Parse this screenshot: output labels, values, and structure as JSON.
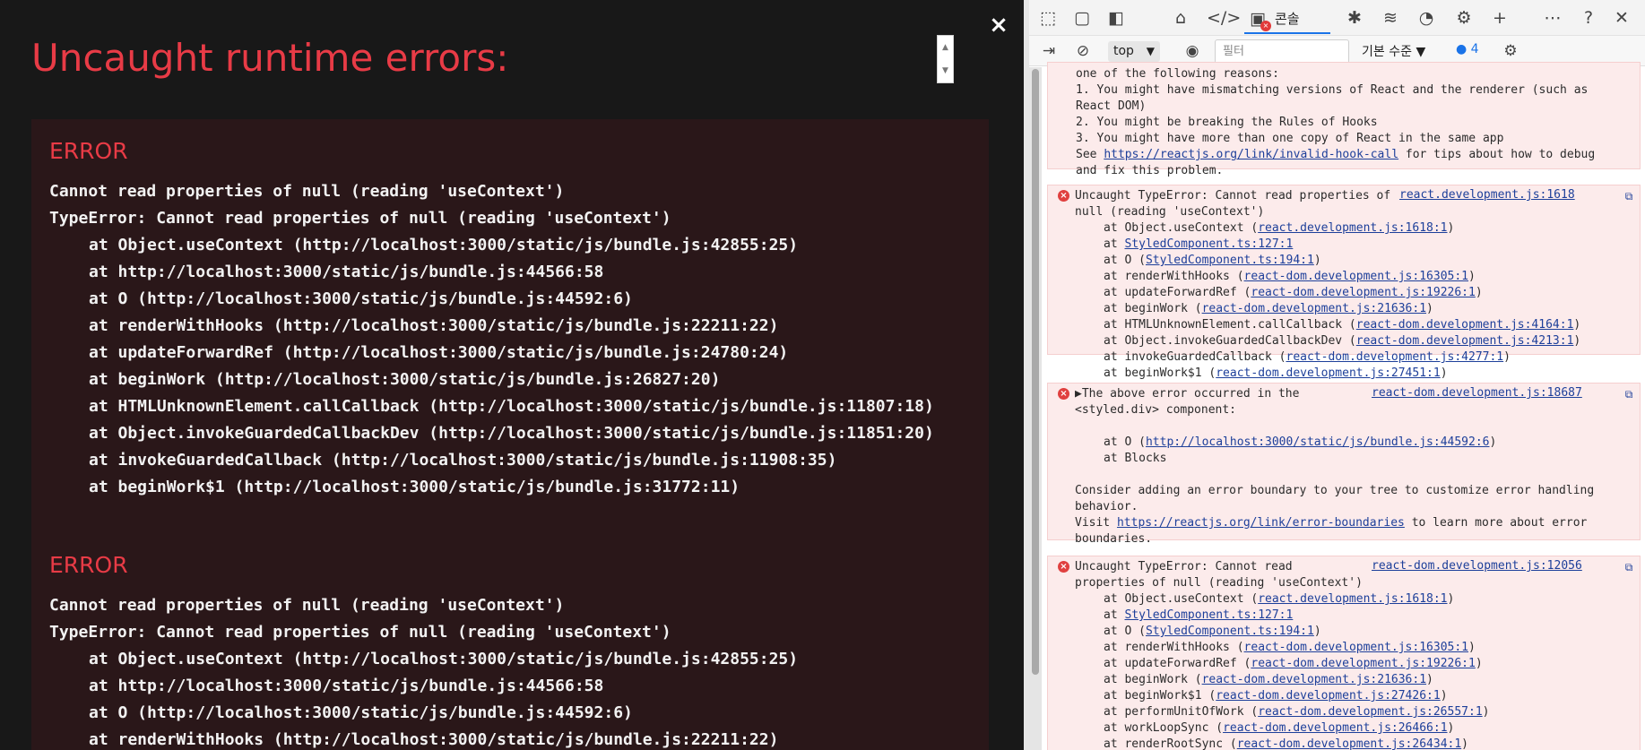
{
  "overlay": {
    "title": "Uncaught runtime errors:",
    "close_label": "×",
    "errors": [
      {
        "heading": "ERROR",
        "lines": [
          "Cannot read properties of null (reading 'useContext')",
          "TypeError: Cannot read properties of null (reading 'useContext')"
        ],
        "stack": [
          "at Object.useContext (http://localhost:3000/static/js/bundle.js:42855:25)",
          "at http://localhost:3000/static/js/bundle.js:44566:58",
          "at O (http://localhost:3000/static/js/bundle.js:44592:6)",
          "at renderWithHooks (http://localhost:3000/static/js/bundle.js:22211:22)",
          "at updateForwardRef (http://localhost:3000/static/js/bundle.js:24780:24)",
          "at beginWork (http://localhost:3000/static/js/bundle.js:26827:20)",
          "at HTMLUnknownElement.callCallback (http://localhost:3000/static/js/bundle.js:11807:18)",
          "at Object.invokeGuardedCallbackDev (http://localhost:3000/static/js/bundle.js:11851:20)",
          "at invokeGuardedCallback (http://localhost:3000/static/js/bundle.js:11908:35)",
          "at beginWork$1 (http://localhost:3000/static/js/bundle.js:31772:11)"
        ]
      },
      {
        "heading": "ERROR",
        "lines": [
          "Cannot read properties of null (reading 'useContext')",
          "TypeError: Cannot read properties of null (reading 'useContext')"
        ],
        "stack": [
          "at Object.useContext (http://localhost:3000/static/js/bundle.js:42855:25)",
          "at http://localhost:3000/static/js/bundle.js:44566:58",
          "at O (http://localhost:3000/static/js/bundle.js:44592:6)",
          "at renderWithHooks (http://localhost:3000/static/js/bundle.js:22211:22)"
        ]
      }
    ]
  },
  "devtools": {
    "console_tab_label": "콘솔",
    "console_badge": "×",
    "context": "top",
    "filter_placeholder": "필터",
    "levels_label": "기본 수준",
    "issues_count": "4",
    "icons": {
      "inspect": "inspect-element-icon",
      "device": "device-emulation-icon",
      "dock": "dock-side-icon",
      "welcome": "home-icon",
      "elements": "elements-icon",
      "console": "console-icon",
      "sources": "bug-icon",
      "network": "wifi-icon",
      "performance": "gauge-icon",
      "memory": "chip-icon",
      "more_tools": "plus-icon",
      "more": "ellipsis-icon",
      "help": "help-icon",
      "close": "close-icon"
    },
    "messages": [
      {
        "type": "text",
        "lines": [
          "one of the following reasons:",
          "1. You might have mismatching versions of React and the renderer (such as",
          "React DOM)",
          "2. You might be breaking the Rules of Hooks",
          "3. You might have more than one copy of React in the same app"
        ],
        "see_prefix": "See ",
        "see_link": "https://reactjs.org/link/invalid-hook-call",
        "see_suffix": " for tips about how to debug",
        "see_last": "and fix this problem."
      },
      {
        "type": "error",
        "source": "react.development.js:1618",
        "header": [
          "Uncaught TypeError: Cannot read properties of",
          "null (reading 'useContext')"
        ],
        "stack": [
          {
            "pre": "at Object.useContext (",
            "link": "react.development.js:1618:1",
            "post": ")"
          },
          {
            "pre": "at ",
            "link": "StyledComponent.ts:127:1",
            "post": ""
          },
          {
            "pre": "at O (",
            "link": "StyledComponent.ts:194:1",
            "post": ")"
          },
          {
            "pre": "at renderWithHooks (",
            "link": "react-dom.development.js:16305:1",
            "post": ")"
          },
          {
            "pre": "at updateForwardRef (",
            "link": "react-dom.development.js:19226:1",
            "post": ")"
          },
          {
            "pre": "at beginWork (",
            "link": "react-dom.development.js:21636:1",
            "post": ")"
          },
          {
            "pre": "at HTMLUnknownElement.callCallback (",
            "link": "react-dom.development.js:4164:1",
            "post": ")"
          },
          {
            "pre": "at Object.invokeGuardedCallbackDev (",
            "link": "react-dom.development.js:4213:1",
            "post": ")"
          },
          {
            "pre": "at invokeGuardedCallback (",
            "link": "react-dom.development.js:4277:1",
            "post": ")"
          },
          {
            "pre": "at beginWork$1 (",
            "link": "react-dom.development.js:27451:1",
            "post": ")"
          }
        ]
      },
      {
        "type": "error",
        "source": "react-dom.development.js:18687",
        "header": [
          "▶The above error occurred in the",
          "<styled.div> component:"
        ],
        "stack": [
          {
            "pre": "",
            "link": "",
            "post": ""
          },
          {
            "pre": "at O (",
            "link": "http://localhost:3000/static/js/bundle.js:44592:6",
            "post": ")"
          },
          {
            "pre": "at Blocks",
            "link": "",
            "post": ""
          }
        ],
        "footer": [
          "Consider adding an error boundary to your tree to customize error handling",
          "behavior."
        ],
        "visit_prefix": "Visit ",
        "visit_link": "https://reactjs.org/link/error-boundaries",
        "visit_suffix": " to learn more about error",
        "visit_last": "boundaries."
      },
      {
        "type": "error",
        "source": "react-dom.development.js:12056",
        "header": [
          "Uncaught TypeError: Cannot read",
          "properties of null (reading 'useContext')"
        ],
        "stack": [
          {
            "pre": "at Object.useContext (",
            "link": "react.development.js:1618:1",
            "post": ")"
          },
          {
            "pre": "at ",
            "link": "StyledComponent.ts:127:1",
            "post": ""
          },
          {
            "pre": "at O (",
            "link": "StyledComponent.ts:194:1",
            "post": ")"
          },
          {
            "pre": "at renderWithHooks (",
            "link": "react-dom.development.js:16305:1",
            "post": ")"
          },
          {
            "pre": "at updateForwardRef (",
            "link": "react-dom.development.js:19226:1",
            "post": ")"
          },
          {
            "pre": "at beginWork (",
            "link": "react-dom.development.js:21636:1",
            "post": ")"
          },
          {
            "pre": "at beginWork$1 (",
            "link": "react-dom.development.js:27426:1",
            "post": ")"
          },
          {
            "pre": "at performUnitOfWork (",
            "link": "react-dom.development.js:26557:1",
            "post": ")"
          },
          {
            "pre": "at workLoopSync (",
            "link": "react-dom.development.js:26466:1",
            "post": ")"
          },
          {
            "pre": "at renderRootSync (",
            "link": "react-dom.development.js:26434:1",
            "post": ")"
          }
        ]
      }
    ]
  }
}
